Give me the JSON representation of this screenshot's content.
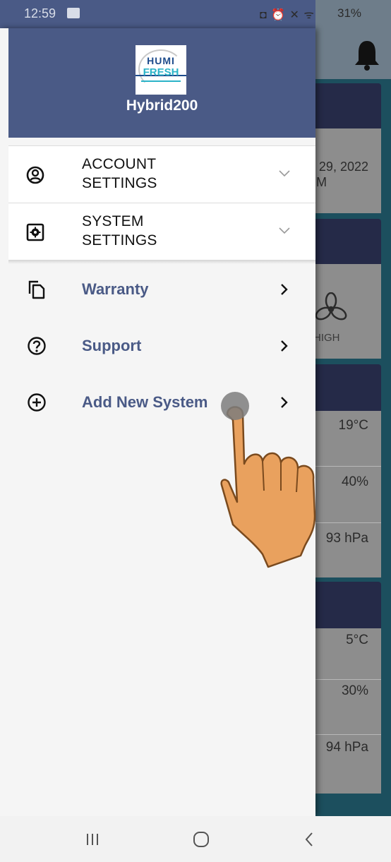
{
  "status_bar": {
    "time": "12:59",
    "icons": "◘ ⏰ ✕ ᯤ ıl",
    "battery": "31%"
  },
  "drawer": {
    "header": {
      "logo_line1": "HUMI",
      "logo_line2": "FRESH",
      "title": "Hybrid200"
    },
    "settings": [
      {
        "label": "ACCOUNT\nSETTINGS",
        "icon": "account-circle-icon"
      },
      {
        "label": "SYSTEM\nSETTINGS",
        "icon": "system-settings-icon"
      }
    ],
    "nav": [
      {
        "label": "Warranty",
        "icon": "copy-document-icon"
      },
      {
        "label": "Support",
        "icon": "help-circle-icon"
      },
      {
        "label": "Add New System",
        "icon": "add-circle-icon"
      }
    ]
  },
  "background": {
    "date": "29, 2022",
    "date_line2": "M",
    "fan_level": "HIGH",
    "indoor": {
      "temp": "19°C",
      "humidity": "40%",
      "pressure": "93 hPa"
    },
    "outdoor": {
      "temp": "5°C",
      "humidity": "30%",
      "pressure": "94 hPa"
    }
  },
  "colors": {
    "drawer_header": "#4a5a86",
    "nav_text": "#4a5a86",
    "card_header": "#252a48",
    "background_teal": "#1c4f5e",
    "touch_hand": "#e9a15e"
  }
}
